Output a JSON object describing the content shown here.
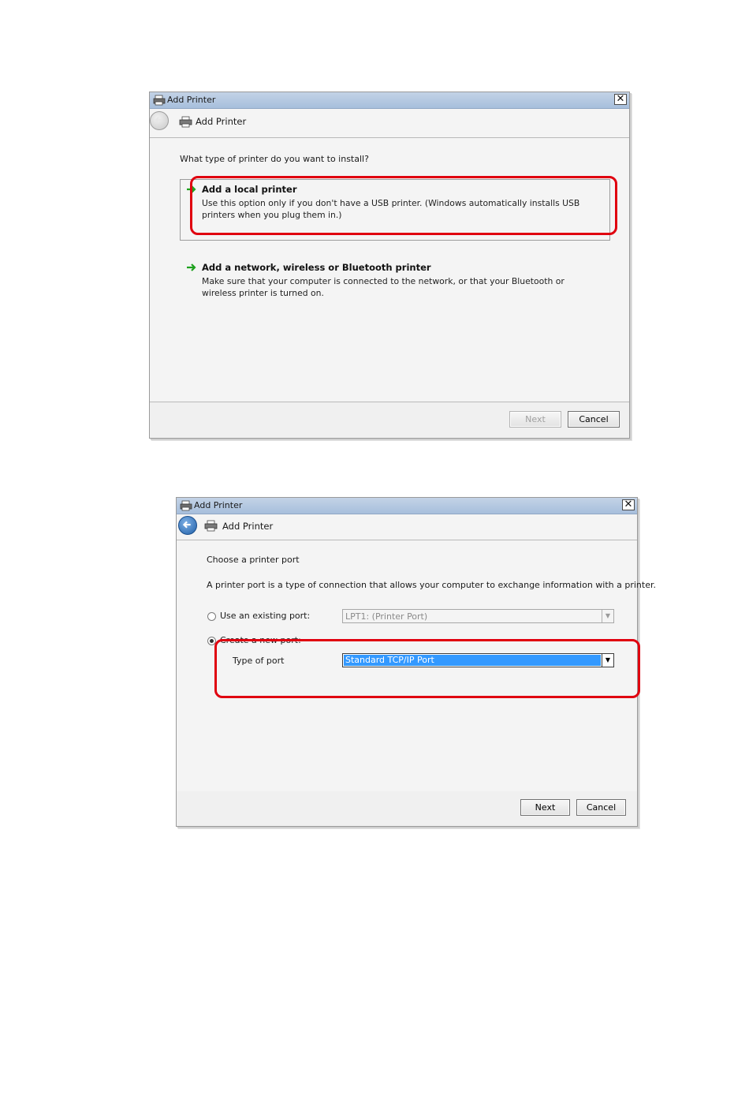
{
  "dialog1": {
    "window_title": "Add Printer",
    "nav_title": "Add Printer",
    "prompt": "What type of printer do you want to install?",
    "options": [
      {
        "title": "Add a local printer",
        "description": "Use this option only if you don't have a USB printer. (Windows automatically installs USB printers when you plug them in.)"
      },
      {
        "title": "Add a network, wireless or Bluetooth printer",
        "description": "Make sure that your computer is connected to the network, or that your Bluetooth or wireless printer is turned on."
      }
    ],
    "next_label": "Next",
    "cancel_label": "Cancel"
  },
  "dialog2": {
    "window_title": "Add Printer",
    "nav_title": "Add Printer",
    "heading": "Choose a printer port",
    "description": "A printer port is a type of connection that allows your computer to exchange information with a printer.",
    "existing_port_label": "Use an existing port:",
    "existing_port_value": "LPT1: (Printer Port)",
    "new_port_label": "Create a new port:",
    "type_of_port_label": "Type of port",
    "type_of_port_value": "Standard TCP/IP Port",
    "next_label": "Next",
    "cancel_label": "Cancel"
  },
  "icons": [
    "printer-icon",
    "close-icon",
    "back-arrow-icon",
    "green-arrow-icon",
    "dropdown-arrow-icon"
  ],
  "colors": {
    "highlight_red": "#e0000f",
    "titlebar_blue": "#b3c8e2",
    "selection_blue": "#3399ff",
    "option_arrow_green": "#1ea11e"
  }
}
